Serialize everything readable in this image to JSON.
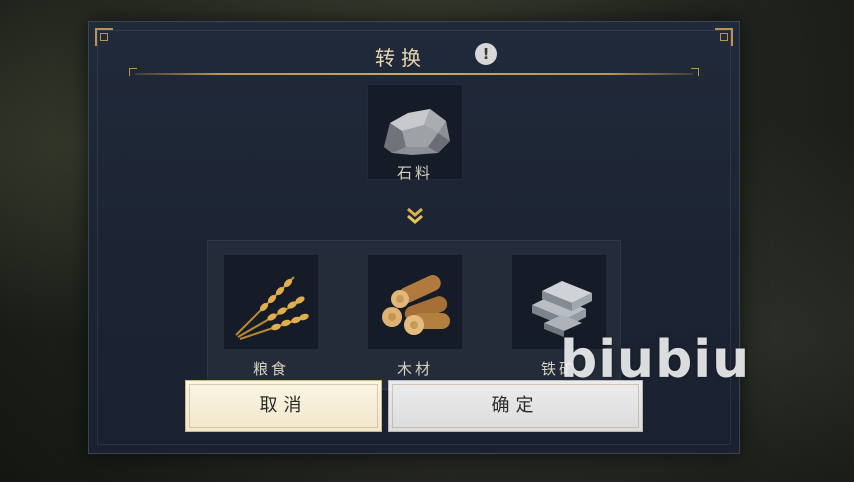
{
  "dialog": {
    "title": "转换",
    "info_icon": "info-exclamation-icon"
  },
  "source": {
    "label": "石料",
    "icon": "stone-icon"
  },
  "arrow_icon": "double-chevron-down-icon",
  "options": [
    {
      "label": "粮食",
      "icon": "wheat-icon"
    },
    {
      "label": "木材",
      "icon": "wood-logs-icon"
    },
    {
      "label": "铁矿",
      "icon": "iron-ingots-icon"
    }
  ],
  "buttons": {
    "cancel": "取消",
    "confirm": "确定"
  },
  "watermark": "biubiu",
  "colors": {
    "accent_gold": "#b99650",
    "panel_bg": "#1c2433",
    "cancel_bg": "#f1e7cb",
    "confirm_bg": "#dcdcdc"
  }
}
